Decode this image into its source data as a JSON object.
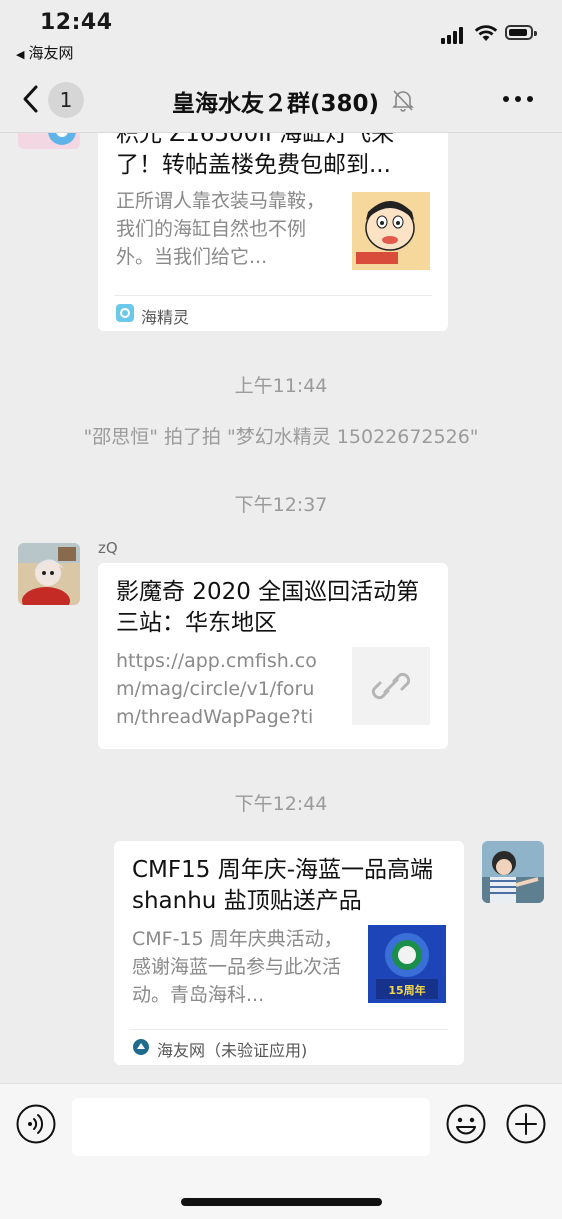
{
  "status_bar": {
    "time": "12:44",
    "back_app": "海友网",
    "icons": [
      "cellular-signal-icon",
      "wifi-icon",
      "battery-icon"
    ]
  },
  "nav": {
    "unread_count": "1",
    "title": "皇海水友２群(380)",
    "icons": [
      "back-chevron-icon",
      "mute-bell-icon",
      "more-dots-icon"
    ]
  },
  "messages": {
    "card1": {
      "title": "积光 Z16500II 海缸灯飞来了！转帖盖楼免费包邮到...",
      "desc": "正所谓人靠衣装马靠鞍，我们的海缸自然也不例外。当我们给它...",
      "source": "海精灵"
    },
    "sys_time1": "上午11:44",
    "sys_pat": "\"邵思恒\" 拍了拍 \"梦幻水精灵 15022672526\"",
    "sys_time2": "下午12:37",
    "msg2": {
      "sender": "zQ",
      "title": "影魔奇 2020 全国巡回活动第三站：华东地区",
      "desc": "https://app.cmfish.com/mag/circle/v1/forum/threadWapPage?tid..."
    },
    "sys_time3": "下午12:44",
    "msg3": {
      "title": "CMF15 周年庆-海蓝一品高端 shanhu 盐顶贴送产品",
      "desc": "CMF-15 周年庆典活动，感谢海蓝一品参与此次活动。青岛海科...",
      "source": "海友网（未验证应用)",
      "thumb_text": "15周年"
    }
  },
  "input": {
    "placeholder": "",
    "icons": [
      "voice-icon",
      "emoji-icon",
      "plus-icon"
    ]
  },
  "colors": {
    "background": "#ededed",
    "bubble": "#ffffff",
    "system_text": "#9b9b9b",
    "link_thumb_bg": "#f2f2f2"
  }
}
